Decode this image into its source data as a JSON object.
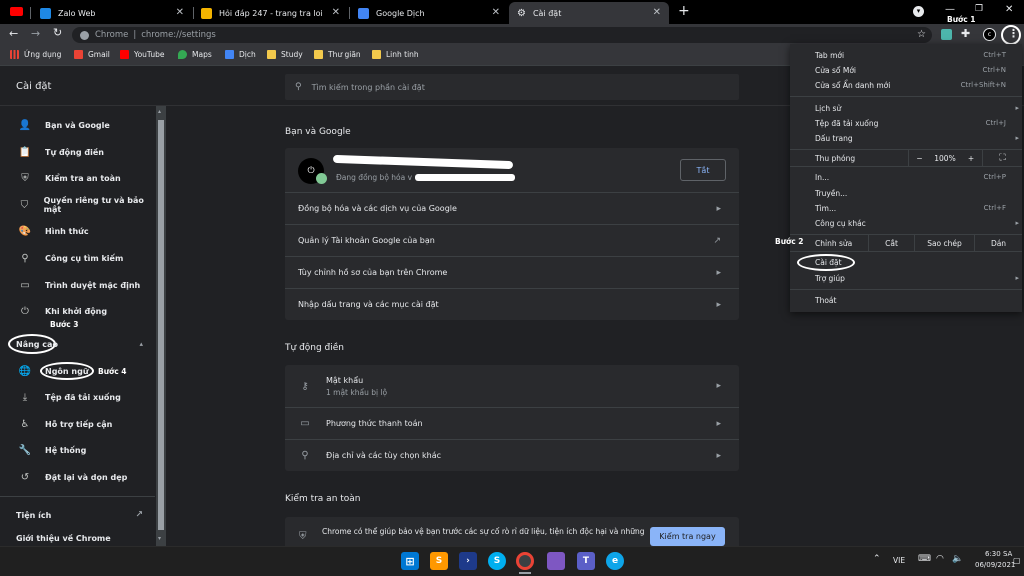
{
  "tabs": [
    {
      "title": "Zalo Web",
      "color": "#1e88e5",
      "icon": "zalo-icon"
    },
    {
      "title": "Hỏi đáp 247 - trang tra loi",
      "color": "#f4b400",
      "icon": "hoidap-icon"
    },
    {
      "title": "Google Dịch",
      "color": "#4285f4",
      "icon": "google-translate-icon"
    },
    {
      "title": "Cài đặt",
      "color": "#9aa0a6",
      "icon": "settings-gear-icon"
    }
  ],
  "new_tab": "+",
  "address": {
    "host": "Chrome",
    "separator": "|",
    "path": "chrome://settings"
  },
  "bookmarks": [
    {
      "label": "Ứng dụng",
      "icon": "apps-grid-icon"
    },
    {
      "label": "Gmail",
      "icon": "gmail-icon"
    },
    {
      "label": "YouTube",
      "icon": "youtube-icon"
    },
    {
      "label": "Maps",
      "icon": "maps-icon"
    },
    {
      "label": "Dịch",
      "icon": "translate-icon"
    },
    {
      "label": "Study",
      "icon": "folder-icon"
    },
    {
      "label": "Thư giãn",
      "icon": "folder-icon"
    },
    {
      "label": "Linh tinh",
      "icon": "folder-icon"
    }
  ],
  "settings": {
    "title": "Cài đặt",
    "search_placeholder": "Tìm kiếm trong phần cài đặt"
  },
  "sidebar": {
    "items": [
      {
        "label": "Bạn và Google",
        "icon": "person-icon"
      },
      {
        "label": "Tự động điền",
        "icon": "clipboard-icon"
      },
      {
        "label": "Kiểm tra an toàn",
        "icon": "shield-check-icon"
      },
      {
        "label": "Quyền riêng tư và bảo mật",
        "icon": "shield-icon"
      },
      {
        "label": "Hình thức",
        "icon": "palette-icon"
      },
      {
        "label": "Công cụ tìm kiếm",
        "icon": "search-icon"
      },
      {
        "label": "Trình duyệt mặc định",
        "icon": "browser-icon"
      },
      {
        "label": "Khi khởi động",
        "icon": "power-icon"
      }
    ],
    "advanced_label": "Nâng cao",
    "advanced_items": [
      {
        "label": "Ngôn ngữ",
        "icon": "globe-icon"
      },
      {
        "label": "Tệp đã tải xuống",
        "icon": "download-icon"
      },
      {
        "label": "Hỗ trợ tiếp cận",
        "icon": "accessibility-icon"
      },
      {
        "label": "Hệ thống",
        "icon": "wrench-icon"
      },
      {
        "label": "Đặt lại và dọn dẹp",
        "icon": "reset-icon"
      }
    ],
    "extensions_label": "Tiện ích",
    "about_label": "Giới thiệu về Chrome"
  },
  "main": {
    "you_google": {
      "title": "Bạn và Google",
      "sync_status": "Đang đồng bộ hóa v",
      "turn_off": "Tắt",
      "rows": [
        "Đồng bộ hóa và các dịch vụ của Google",
        "Quản lý Tài khoản Google của bạn",
        "Tùy chỉnh hồ sơ của bạn trên Chrome",
        "Nhập dấu trang và các mục cài đặt"
      ]
    },
    "autofill": {
      "title": "Tự động điền",
      "passwords": "Mật khẩu",
      "passwords_sub": "1 mật khẩu bị lộ",
      "payment": "Phương thức thanh toán",
      "addresses": "Địa chỉ và các tùy chọn khác"
    },
    "safety": {
      "title": "Kiểm tra an toàn",
      "text": "Chrome có thể giúp bảo vệ bạn trước các sự cố rò rỉ dữ liệu, tiện ích độc hại và những",
      "check_now": "Kiểm tra ngay"
    }
  },
  "menu": {
    "new_tab": {
      "label": "Tab mới",
      "shortcut": "Ctrl+T"
    },
    "new_window": {
      "label": "Cửa sổ Mới",
      "shortcut": "Ctrl+N"
    },
    "incognito": {
      "label": "Cửa sổ Ẩn danh mới",
      "shortcut": "Ctrl+Shift+N"
    },
    "history": {
      "label": "Lịch sử"
    },
    "downloads": {
      "label": "Tệp đã tải xuống",
      "shortcut": "Ctrl+J"
    },
    "bookmarks": {
      "label": "Dấu trang"
    },
    "zoom": {
      "label": "Thu phóng",
      "minus": "−",
      "value": "100%",
      "plus": "+"
    },
    "print": {
      "label": "In...",
      "shortcut": "Ctrl+P"
    },
    "cast": {
      "label": "Truyền..."
    },
    "find": {
      "label": "Tìm...",
      "shortcut": "Ctrl+F"
    },
    "more_tools": {
      "label": "Công cụ khác"
    },
    "edit": {
      "label": "Chỉnh sửa",
      "cut": "Cắt",
      "copy": "Sao chép",
      "paste": "Dán"
    },
    "settings": {
      "label": "Cài đặt"
    },
    "help": {
      "label": "Trợ giúp"
    },
    "exit": {
      "label": "Thoát"
    }
  },
  "annotations": {
    "step1": "Bước 1",
    "step2": "Bước 2",
    "step3": "Bước 3",
    "step4": "Bước 4"
  },
  "taskbar": {
    "lang": "VIE",
    "time": "6:30 SA",
    "date": "06/09/2021"
  }
}
